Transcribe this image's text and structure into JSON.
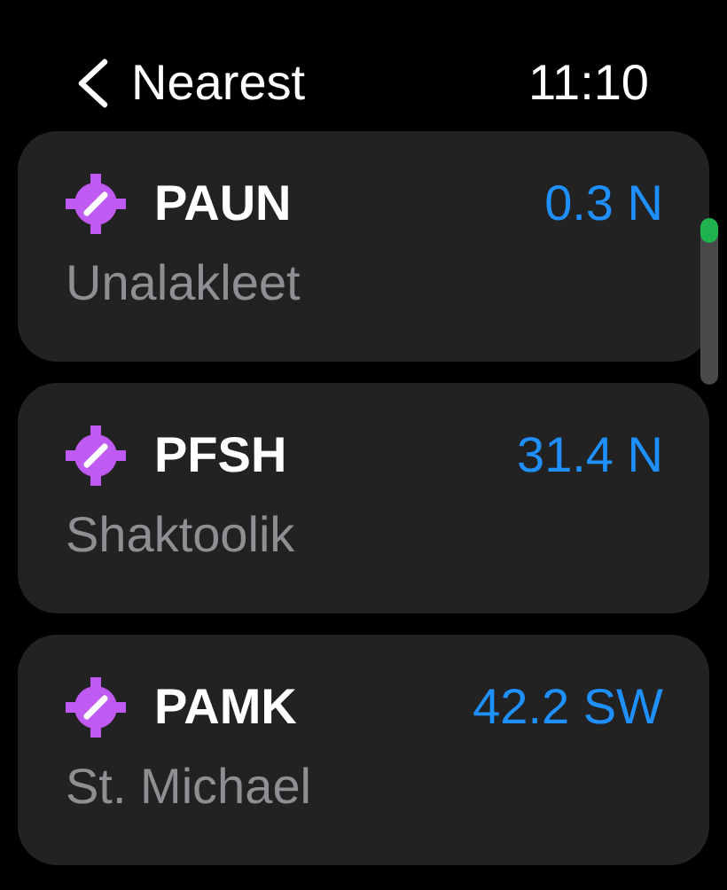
{
  "header": {
    "back_label": "Nearest",
    "time": "11:10"
  },
  "airports": [
    {
      "code": "PAUN",
      "distance": "0.3 N",
      "city": "Unalakleet"
    },
    {
      "code": "PFSH",
      "distance": "31.4 N",
      "city": "Shaktoolik"
    },
    {
      "code": "PAMK",
      "distance": "42.2 SW",
      "city": "St. Michael"
    }
  ]
}
